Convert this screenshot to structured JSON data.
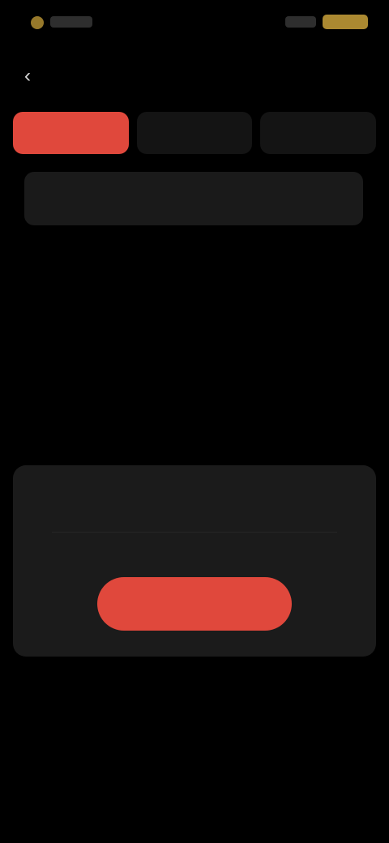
{
  "status_bar": {
    "time": "",
    "battery": ""
  },
  "header": {
    "back_icon": "‹",
    "title": ""
  },
  "tabs": [
    {
      "label": "",
      "active": true
    },
    {
      "label": "",
      "active": false
    },
    {
      "label": "",
      "active": false
    }
  ],
  "search": {
    "placeholder": "",
    "value": ""
  },
  "section": {
    "title": "",
    "action_label": ""
  },
  "empty_state": {
    "message": "",
    "button_label": ""
  },
  "colors": {
    "accent": "#e0483c",
    "background": "#000000",
    "card": "#1b1b1b",
    "status_accent": "#c9a13a"
  },
  "icons": {
    "back": "chevron-left-icon",
    "status_indicator": "status-dot-icon",
    "battery": "battery-icon"
  }
}
